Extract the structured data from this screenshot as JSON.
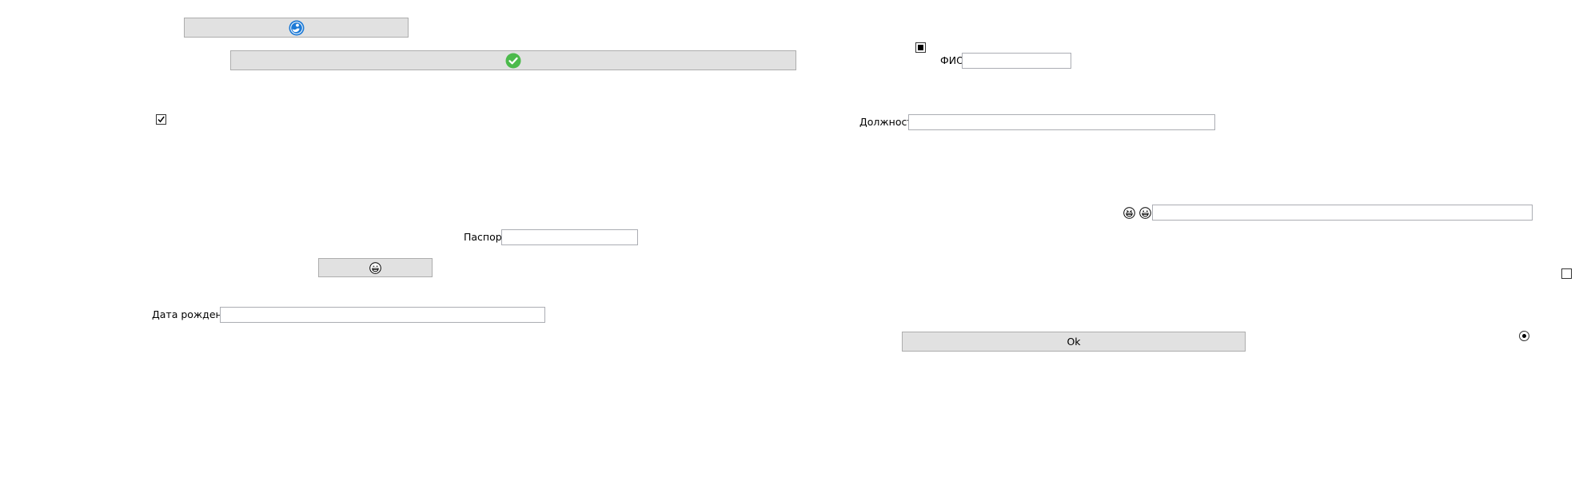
{
  "buttons": {
    "top_icon_button": {
      "icon": "blue-person-icon"
    },
    "check_button": {
      "icon": "green-check-icon"
    },
    "smiley_button": {
      "icon": "grinning-face-icon"
    },
    "ok_button": {
      "label": "Ok"
    }
  },
  "fields": {
    "passport": {
      "label": "Паспорт",
      "value": ""
    },
    "birth_date": {
      "label": "Дата рождения",
      "value": ""
    },
    "fio": {
      "label": "ФИО",
      "value": ""
    },
    "position": {
      "label": "Должность",
      "value": ""
    },
    "emoji_field": {
      "value": ""
    }
  },
  "emoji_icons": [
    "grinning-squint-face-icon",
    "grinning-face-icon"
  ],
  "controls": {
    "checkbox_left": {
      "checked": true
    },
    "checkbox_top_right": {
      "state": "indeterminate"
    },
    "checkbox_far_right": {
      "checked": false
    },
    "radio_right": {
      "selected": true
    }
  },
  "colors": {
    "button_bg": "#e1e1e1",
    "button_border": "#adadad",
    "input_border": "#abadb3",
    "check_green": "#4cba4c",
    "person_blue": "#1d7ad6"
  }
}
